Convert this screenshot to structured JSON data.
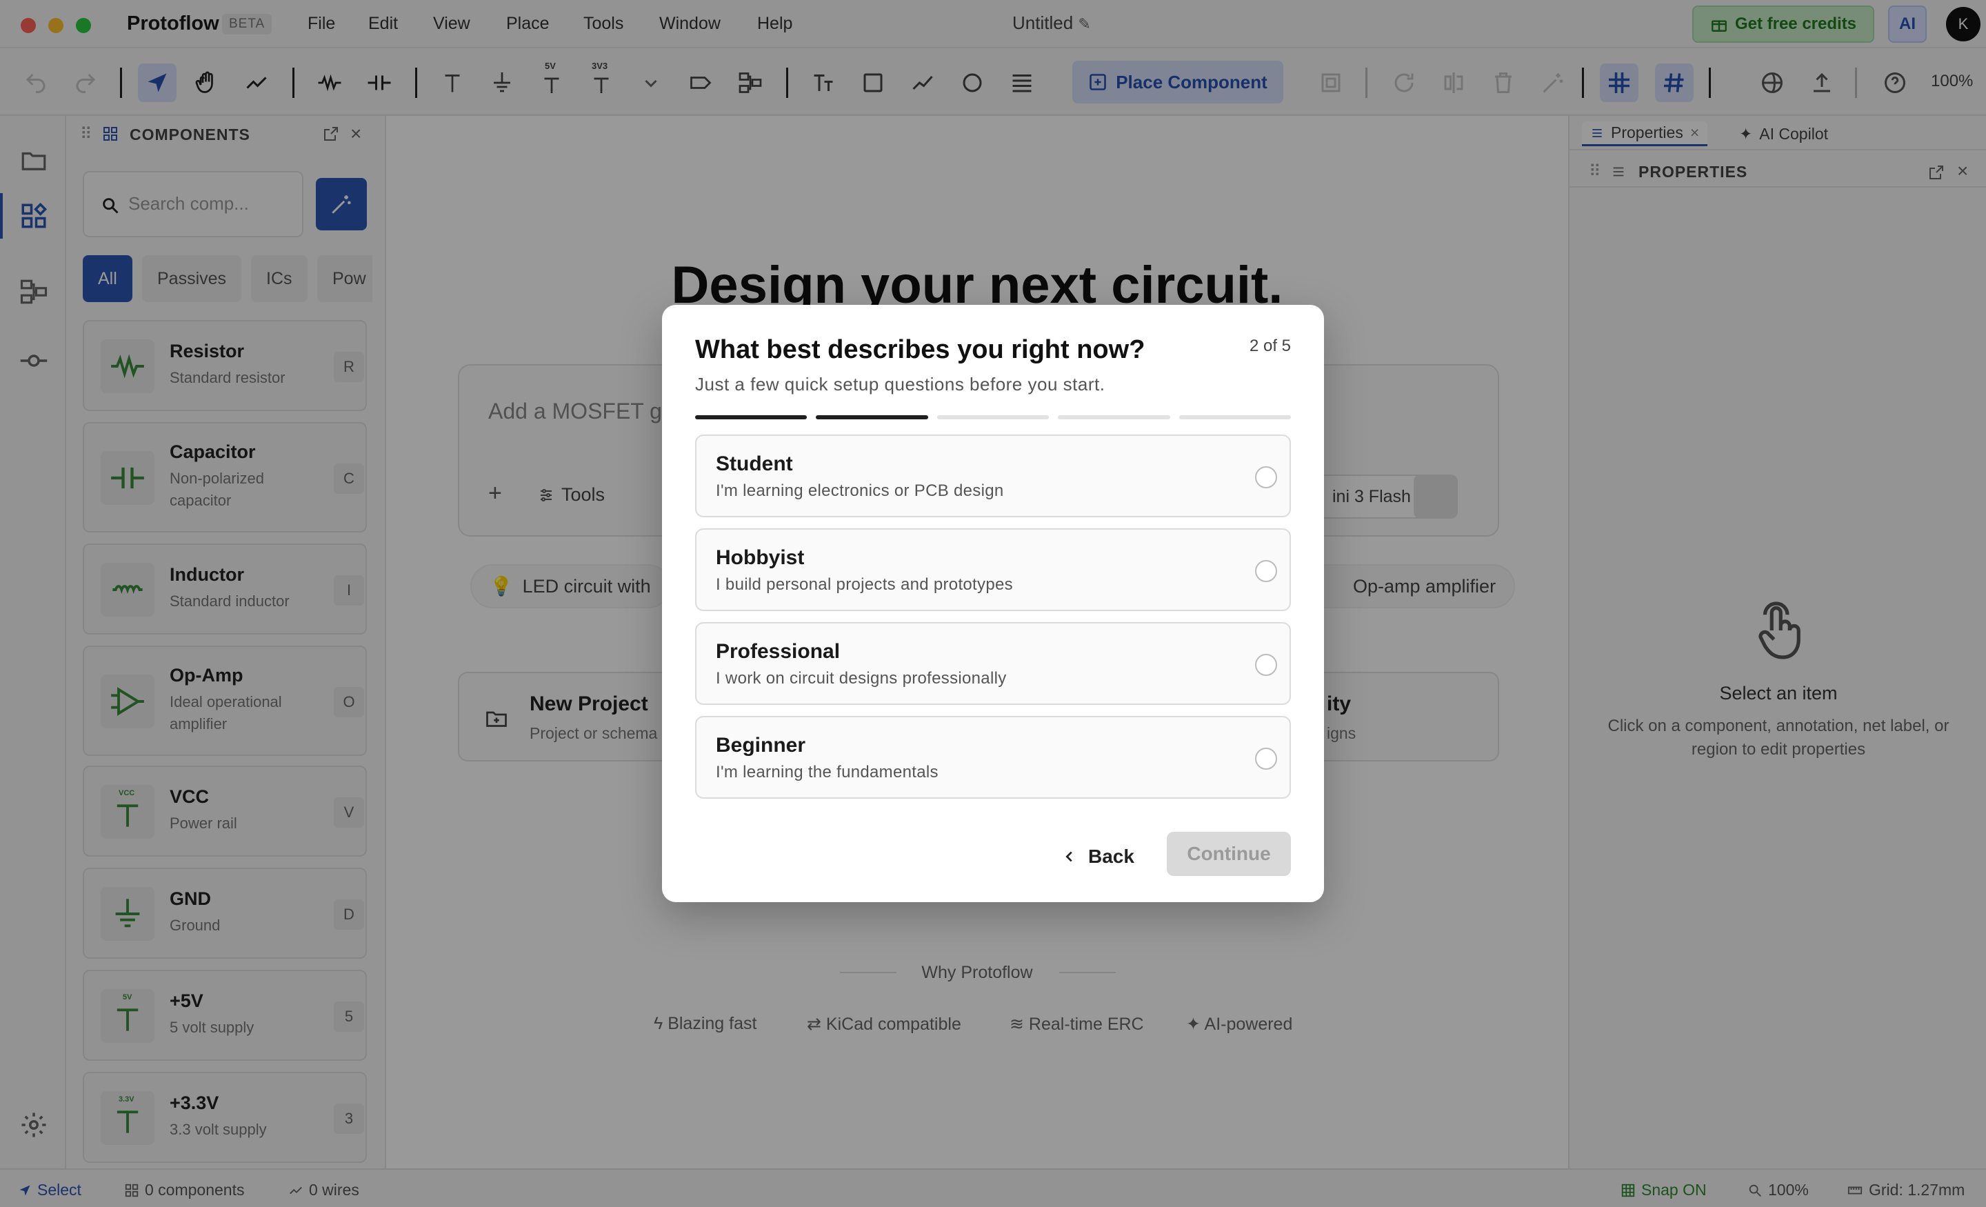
{
  "titlebar": {
    "app_name": "Protoflow",
    "badge": "BETA",
    "menus": [
      "File",
      "Edit",
      "View",
      "Place",
      "Tools",
      "Window",
      "Help"
    ],
    "doc_title": "Untitled",
    "credits_label": "Get free credits",
    "ai_label": "AI",
    "avatar_initial": "K"
  },
  "toolbar": {
    "place_component_label": "Place Component",
    "zoom": "100%",
    "vcc_5v_label": "5V",
    "vcc_3v3_label": "3V3"
  },
  "components_panel": {
    "title": "COMPONENTS",
    "search_placeholder": "Search comp...",
    "filters": [
      "All",
      "Passives",
      "ICs",
      "Pow"
    ],
    "items": [
      {
        "name": "Resistor",
        "desc": "Standard resistor",
        "key": "R",
        "icon": "resistor-icon"
      },
      {
        "name": "Capacitor",
        "desc": "Non-polarized capacitor",
        "key": "C",
        "icon": "capacitor-icon"
      },
      {
        "name": "Inductor",
        "desc": "Standard inductor",
        "key": "I",
        "icon": "inductor-icon"
      },
      {
        "name": "Op-Amp",
        "desc": "Ideal operational amplifier",
        "key": "O",
        "icon": "opamp-icon"
      },
      {
        "name": "VCC",
        "desc": "Power rail",
        "key": "V",
        "icon": "vcc-icon"
      },
      {
        "name": "GND",
        "desc": "Ground",
        "key": "D",
        "icon": "ground-icon"
      },
      {
        "name": "+5V",
        "desc": "5 volt supply",
        "key": "5",
        "icon": "supply-5v-icon"
      },
      {
        "name": "+3.3V",
        "desc": "3.3 volt supply",
        "key": "3",
        "icon": "supply-3v3-icon"
      }
    ],
    "icon_labels": {
      "vcc": "VCC",
      "v5": "5V",
      "v33": "3.3V"
    }
  },
  "canvas": {
    "hero": "Design your next circuit.",
    "prompt_placeholder": "Add a MOSFET g",
    "tools_label": "Tools",
    "model_label": "ini 3 Flash",
    "suggestions": [
      "LED circuit with",
      "Op-amp amplifier"
    ],
    "new_project_title": "New Project",
    "new_project_desc": "Project or schema",
    "right_card_title": "ity",
    "right_card_desc": "igns",
    "why_label": "Why Protoflow",
    "features": [
      "Blazing fast",
      "KiCad compatible",
      "Real-time ERC",
      "AI-powered"
    ]
  },
  "properties_panel": {
    "tabs": [
      "Properties",
      "AI Copilot"
    ],
    "title": "PROPERTIES",
    "empty_title": "Select an item",
    "empty_desc": "Click on a component, annotation, net label, or region to edit properties"
  },
  "status_bar": {
    "mode": "Select",
    "components": "0 components",
    "wires": "0 wires",
    "snap": "Snap ON",
    "zoom": "100%",
    "grid": "Grid: 1.27mm"
  },
  "modal": {
    "title": "What best describes you right now?",
    "subtitle": "Just a few quick setup questions before you start.",
    "step": "2 of 5",
    "progress": {
      "current": 2,
      "total": 5
    },
    "options": [
      {
        "title": "Student",
        "desc": "I'm learning electronics or PCB design"
      },
      {
        "title": "Hobbyist",
        "desc": "I build personal projects and prototypes"
      },
      {
        "title": "Professional",
        "desc": "I work on circuit designs professionally"
      },
      {
        "title": "Beginner",
        "desc": "I'm learning the fundamentals"
      }
    ],
    "back_label": "Back",
    "continue_label": "Continue"
  },
  "colors": {
    "accent": "#2d55b3",
    "component_green": "#3a8a3a",
    "credits_green": "#227a22"
  }
}
